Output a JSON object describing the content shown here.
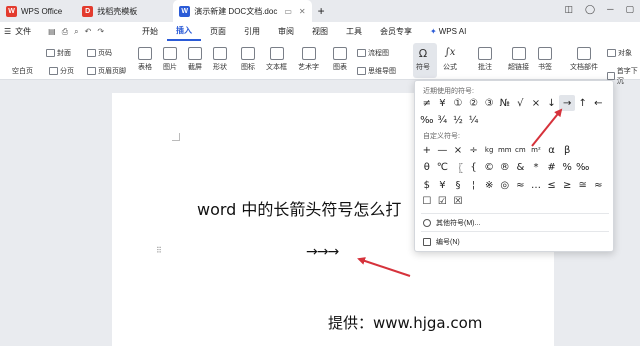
{
  "tabs": [
    {
      "label": "WPS Office",
      "icon": "wps-icon",
      "color": "#e33b2e"
    },
    {
      "label": "找稻壳模板",
      "icon": "docer-icon",
      "color": "#e33b2e"
    },
    {
      "label": "演示新建 DOC文档.doc",
      "icon": "word-doc-icon",
      "color": "#2b5bd7"
    }
  ],
  "menu": [
    "文件",
    "开始",
    "插入",
    "页面",
    "引用",
    "审阅",
    "视图",
    "工具",
    "会员专享",
    "WPS AI"
  ],
  "ribbon": {
    "blank_page": "空白页",
    "cover": "封面",
    "section": "分页",
    "page_num": "页码",
    "header_footer": "页眉页脚",
    "table": "表格",
    "picture": "图片",
    "screenshot": "截屏",
    "shape": "形状",
    "icon": "图标",
    "textbox": "文本框",
    "art": "艺术字",
    "chart": "图表",
    "flowchart": "流程图",
    "mindmap": "思维导图",
    "symbol": "符号",
    "formula": "公式",
    "comment": "批注",
    "hyperlink": "超链接",
    "bookmark": "书签",
    "doc_parts": "文档部件",
    "object": "对象",
    "dropcap": "首字下沉"
  },
  "panel": {
    "recent_title": "近期使用的符号:",
    "recent_row1": [
      "≠",
      "¥",
      "①",
      "②",
      "③",
      "№",
      "√",
      "×",
      "↓",
      "→",
      "↑",
      "←"
    ],
    "recent_row2": [
      "‰",
      "¾",
      "½",
      "¼"
    ],
    "custom_title": "自定义符号:",
    "custom_row1": [
      "+",
      "—",
      "×",
      "÷",
      "kg",
      "mm",
      "cm",
      "m²",
      "α",
      "β"
    ],
    "custom_row2": [
      "θ",
      "℃",
      "〖",
      "{",
      "©",
      "®",
      "&",
      "*",
      "#",
      "%",
      "‰"
    ],
    "custom_row3": [
      "$",
      "¥",
      "§",
      "¦",
      "※",
      "◎",
      "≈",
      "…",
      "≤",
      "≥",
      "≅",
      "≈"
    ],
    "custom_row4": [
      "☐",
      "☑",
      "☒"
    ],
    "other_symbols": "其他符号(M)...",
    "numbering": "编号(N)"
  },
  "document": {
    "title": "word 中的长箭头符号怎么打",
    "arrows": "→→→",
    "provider": "提供：www.hjga.com"
  },
  "colors": {
    "accent": "#2b5bd7",
    "arrow": "#d6323b"
  }
}
